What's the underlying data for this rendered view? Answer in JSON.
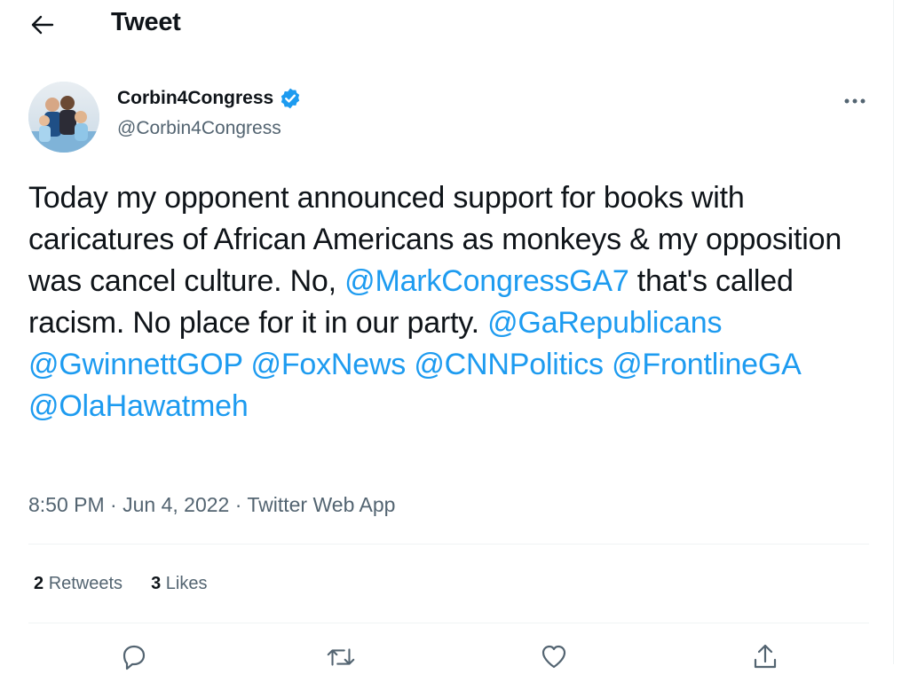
{
  "header": {
    "title": "Tweet"
  },
  "author": {
    "display_name": "Corbin4Congress",
    "handle": "@Corbin4Congress",
    "verified": true
  },
  "tweet": {
    "segments": [
      {
        "text": "Today my opponent announced support for books with caricatures of African Americans as monkeys & my opposition was cancel culture. No, ",
        "mention": false
      },
      {
        "text": "@MarkCongressGA7",
        "mention": true
      },
      {
        "text": " that's called racism. No place for it in our party. ",
        "mention": false
      },
      {
        "text": "@GaRepublicans",
        "mention": true
      },
      {
        "text": " ",
        "mention": false
      },
      {
        "text": "@GwinnettGOP",
        "mention": true
      },
      {
        "text": " ",
        "mention": false
      },
      {
        "text": "@FoxNews",
        "mention": true
      },
      {
        "text": " ",
        "mention": false
      },
      {
        "text": "@CNNPolitics",
        "mention": true
      },
      {
        "text": " ",
        "mention": false
      },
      {
        "text": "@FrontlineGA",
        "mention": true
      },
      {
        "text": " ",
        "mention": false
      },
      {
        "text": "@OlaHawatmeh",
        "mention": true
      }
    ],
    "time": "8:50 PM",
    "separator": " · ",
    "date": "Jun 4, 2022",
    "source": "Twitter Web App"
  },
  "stats": {
    "retweets_count": "2",
    "retweets_label": "Retweets",
    "likes_count": "3",
    "likes_label": "Likes"
  },
  "actions": [
    {
      "icon": "reply-icon"
    },
    {
      "icon": "retweet-icon"
    },
    {
      "icon": "like-icon"
    },
    {
      "icon": "share-icon"
    }
  ],
  "colors": {
    "accent": "#1d9bf0",
    "text": "#0f1419",
    "secondary": "#536471",
    "divider": "#eff3f4"
  }
}
